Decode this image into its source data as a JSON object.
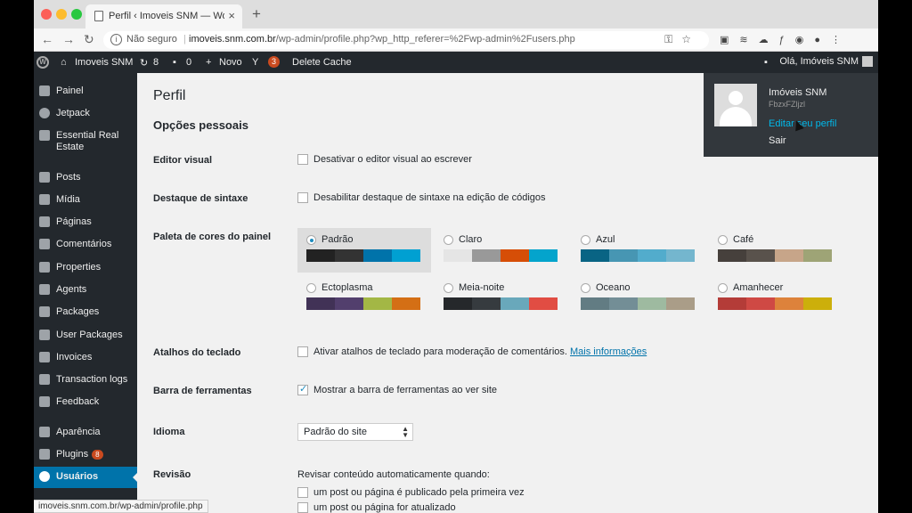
{
  "browser": {
    "tab_title": "Perfil ‹ Imoveis SNM — WordPress",
    "tab_close": "×",
    "new_tab": "+",
    "not_secure": "Não seguro",
    "url_host": "imoveis.snm.com.br",
    "url_path": "/wp-admin/profile.php?wp_http_referer=%2Fwp-admin%2Fusers.php",
    "status_url": "imoveis.snm.com.br/wp-admin/profile.php"
  },
  "adminbar": {
    "site_name": "Imoveis SNM",
    "updates_count": "8",
    "comments_count": "0",
    "new_label": "Novo",
    "yoast_count": "3",
    "delete_cache": "Delete Cache",
    "howdy": "Olá, Imóveis SNM"
  },
  "sidebar": {
    "items": [
      {
        "label": "Painel"
      },
      {
        "label": "Jetpack"
      },
      {
        "label": "Essential Real Estate"
      },
      {
        "label": "Posts"
      },
      {
        "label": "Mídia"
      },
      {
        "label": "Páginas"
      },
      {
        "label": "Comentários"
      },
      {
        "label": "Properties"
      },
      {
        "label": "Agents"
      },
      {
        "label": "Packages"
      },
      {
        "label": "User Packages"
      },
      {
        "label": "Invoices"
      },
      {
        "label": "Transaction logs"
      },
      {
        "label": "Feedback"
      },
      {
        "label": "Aparência"
      },
      {
        "label": "Plugins",
        "badge": "8"
      },
      {
        "label": "Usuários",
        "active": true
      }
    ]
  },
  "main": {
    "page_title": "Perfil",
    "section_title": "Opções pessoais",
    "visual_editor": {
      "label": "Editor visual",
      "option": "Desativar o editor visual ao escrever",
      "checked": false
    },
    "syntax": {
      "label": "Destaque de sintaxe",
      "option": "Desabilitar destaque de sintaxe na edição de códigos",
      "checked": false
    },
    "color_scheme": {
      "label": "Paleta de cores do painel",
      "schemes": [
        {
          "name": "Padrão",
          "selected": true,
          "colors": [
            "#222222",
            "#333333",
            "#0073aa",
            "#00a0d2"
          ]
        },
        {
          "name": "Claro",
          "selected": false,
          "colors": [
            "#e5e5e5",
            "#999999",
            "#d64e07",
            "#04a4cc"
          ]
        },
        {
          "name": "Azul",
          "selected": false,
          "colors": [
            "#096484",
            "#4796b3",
            "#52accc",
            "#74b6ce"
          ]
        },
        {
          "name": "Café",
          "selected": false,
          "colors": [
            "#46403c",
            "#59524c",
            "#c7a589",
            "#9ea476"
          ]
        },
        {
          "name": "Ectoplasma",
          "selected": false,
          "colors": [
            "#413256",
            "#523f6d",
            "#a3b745",
            "#d46f15"
          ]
        },
        {
          "name": "Meia-noite",
          "selected": false,
          "colors": [
            "#25282b",
            "#363b3f",
            "#69a8bb",
            "#e14d43"
          ]
        },
        {
          "name": "Oceano",
          "selected": false,
          "colors": [
            "#627c83",
            "#738e96",
            "#9ebaa0",
            "#aa9d88"
          ]
        },
        {
          "name": "Amanhecer",
          "selected": false,
          "colors": [
            "#b43c38",
            "#cf4944",
            "#dd823b",
            "#ccaf0b"
          ]
        }
      ]
    },
    "shortcuts": {
      "label": "Atalhos do teclado",
      "option": "Ativar atalhos de teclado para moderação de comentários.",
      "link": "Mais informações",
      "checked": false
    },
    "toolbar": {
      "label": "Barra de ferramentas",
      "option": "Mostrar a barra de ferramentas ao ver site",
      "checked": true
    },
    "language": {
      "label": "Idioma",
      "value": "Padrão do site"
    },
    "revision": {
      "label": "Revisão",
      "intro": "Revisar conteúdo automaticamente quando:",
      "option1": "um post ou página é publicado pela primeira vez",
      "option2": "um post ou página for atualizado"
    }
  },
  "user_menu": {
    "display_name": "Imóveis SNM",
    "login": "FbzxFZljzl",
    "edit_profile": "Editar seu perfil",
    "logout": "Sair"
  }
}
